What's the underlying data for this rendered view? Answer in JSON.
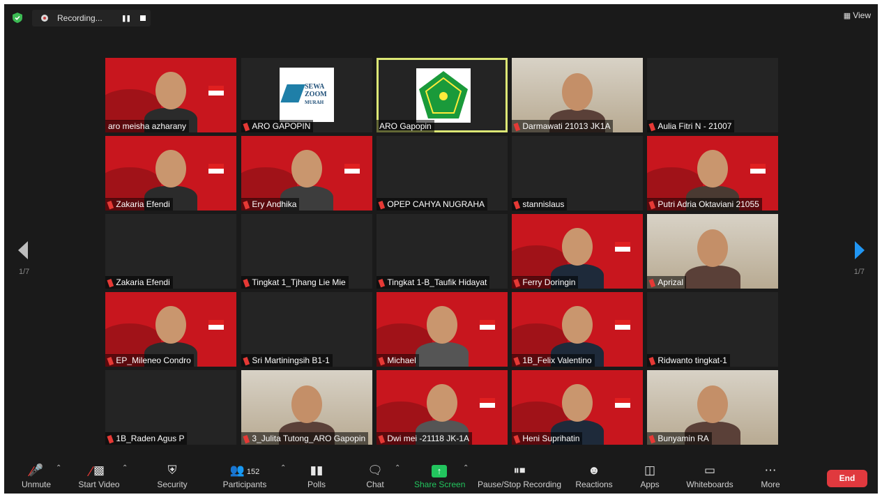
{
  "topbar": {
    "recording_label": "Recording...",
    "view_label": "View"
  },
  "pagination": {
    "left": "1/7",
    "right": "1/7"
  },
  "tiles": [
    {
      "name": "aro meisha azharany",
      "muted": false,
      "type": "video-red"
    },
    {
      "name": "ARO GAPOPIN",
      "muted": true,
      "type": "logo-sewa"
    },
    {
      "name": "ARO Gapopin",
      "muted": false,
      "type": "logo-green",
      "active": true
    },
    {
      "name": "Darmawati 21013 JK1A",
      "muted": true,
      "type": "video-room"
    },
    {
      "name": "Aulia Fitri N - 21007",
      "muted": true,
      "type": "blank"
    },
    {
      "name": "Zakaria Efendi",
      "muted": true,
      "type": "video-red"
    },
    {
      "name": "Ery Andhika",
      "muted": true,
      "type": "video-red"
    },
    {
      "name": "OPEP CAHYA NUGRAHA",
      "muted": true,
      "type": "blank"
    },
    {
      "name": "stannislaus",
      "muted": true,
      "type": "blank"
    },
    {
      "name": "Putri Adria Oktaviani 21055",
      "muted": true,
      "type": "video-red"
    },
    {
      "name": "Zakaria Efendi",
      "muted": true,
      "type": "blank"
    },
    {
      "name": "Tingkat 1_Tjhang Lie Mie",
      "muted": true,
      "type": "blank"
    },
    {
      "name": "Tingkat 1-B_Taufik Hidayat",
      "muted": true,
      "type": "blank"
    },
    {
      "name": "Ferry Doringin",
      "muted": true,
      "type": "video-red"
    },
    {
      "name": "Aprizal",
      "muted": true,
      "type": "video-room"
    },
    {
      "name": "EP_Mileneo Condro",
      "muted": true,
      "type": "video-red"
    },
    {
      "name": "Sri Martiningsih B1-1",
      "muted": true,
      "type": "blank"
    },
    {
      "name": "Michael",
      "muted": true,
      "type": "video-red"
    },
    {
      "name": "1B_Felix Valentino",
      "muted": true,
      "type": "video-red"
    },
    {
      "name": "Ridwanto tingkat-1",
      "muted": true,
      "type": "blank"
    },
    {
      "name": "1B_Raden Agus P",
      "muted": true,
      "type": "blank"
    },
    {
      "name": "3_Julita Tutong_ARO Gapopin",
      "muted": true,
      "type": "video-room"
    },
    {
      "name": "Dwi mei -21118 JK-1A",
      "muted": true,
      "type": "video-red"
    },
    {
      "name": "Heni Suprihatin",
      "muted": true,
      "type": "video-red"
    },
    {
      "name": "Bunyamin RA",
      "muted": true,
      "type": "video-room"
    }
  ],
  "logos": {
    "sewa_line1": "SEWA",
    "sewa_line2": "ZOOM",
    "sewa_line3": "MURAH"
  },
  "toolbar": {
    "unmute": "Unmute",
    "start_video": "Start Video",
    "security": "Security",
    "participants": "Participants",
    "participants_count": "152",
    "polls": "Polls",
    "chat": "Chat",
    "share_screen": "Share Screen",
    "pause_stop_recording": "Pause/Stop Recording",
    "reactions": "Reactions",
    "apps": "Apps",
    "whiteboards": "Whiteboards",
    "more": "More",
    "end": "End"
  },
  "colors": {
    "background": "#1a1a1a",
    "tile": "#242424",
    "active_outline": "#dce775",
    "muted_mic": "#e53935",
    "share_green": "#22c55e",
    "end_red": "#e0393e",
    "next_arrow": "#2196f3"
  }
}
